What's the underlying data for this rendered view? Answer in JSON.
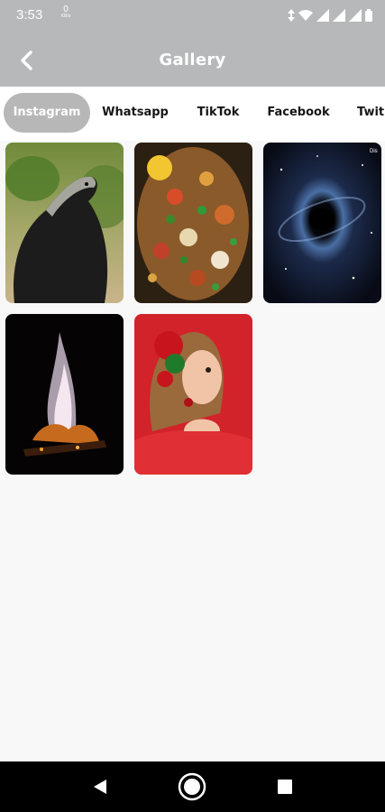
{
  "status_bar": {
    "time": "3:53",
    "data_rate_value": "0",
    "data_rate_unit": "KB/s",
    "icons": [
      "data-arrows-icon",
      "wifi-icon",
      "signal-icon",
      "signal-icon",
      "signal-icon",
      "battery-icon"
    ]
  },
  "app_bar": {
    "title": "Gallery",
    "back_icon": "chevron-left-icon",
    "background": "#b6b8b9"
  },
  "tabs": [
    {
      "label": "Instagram",
      "selected": true
    },
    {
      "label": "Whatsapp",
      "selected": false
    },
    {
      "label": "TikTok",
      "selected": false
    },
    {
      "label": "Facebook",
      "selected": false
    },
    {
      "label": "Twit",
      "selected": false
    }
  ],
  "gallery": {
    "images": [
      {
        "subject": "honey badger"
      },
      {
        "subject": "vegetable dish"
      },
      {
        "subject": "black hole galaxy",
        "corner_text": "Dis"
      },
      {
        "subject": "campfire"
      },
      {
        "subject": "woman with red flowers"
      }
    ]
  },
  "nav_bar": {
    "icons": [
      "back-triangle-icon",
      "home-circle-icon",
      "recents-square-icon"
    ]
  },
  "colors": {
    "accent": "#b7b7b7",
    "background": "#f8f8f8",
    "text": "#161616"
  }
}
